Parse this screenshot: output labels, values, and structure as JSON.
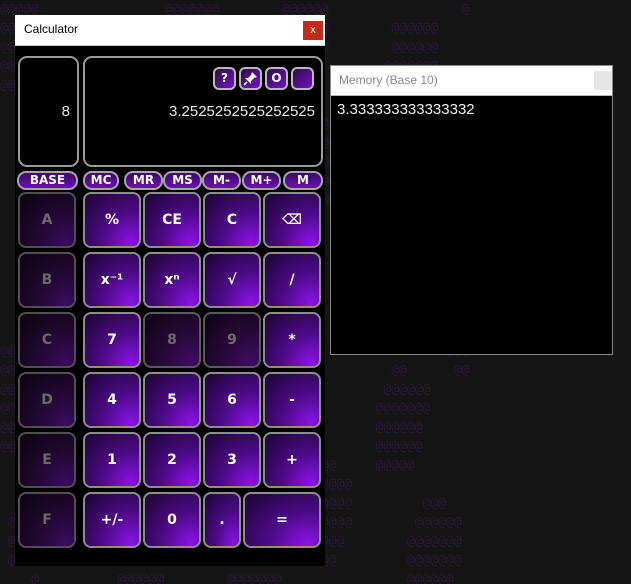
{
  "colors": {
    "accent": "#7a10c8",
    "close_red": "#c42b1c"
  },
  "calculator": {
    "title": "Calculator",
    "close_label": "x",
    "base_value": "8",
    "display_value": "3.2525252525252525",
    "tools": {
      "help": "?",
      "pin_icon": "pin-icon",
      "settings": "O",
      "toggle": ""
    },
    "memory_row": {
      "base": "BASE",
      "mc": "MC",
      "mr": "MR",
      "ms": "MS",
      "m_minus": "M-",
      "m_plus": "M+",
      "m": "M"
    },
    "keys": {
      "a": "A",
      "percent": "%",
      "ce": "CE",
      "c": "C",
      "backspace": "⌫",
      "b": "B",
      "inverse": "x⁻¹",
      "power": "xⁿ",
      "sqrt": "√",
      "divide": "/",
      "hex_c": "C",
      "seven": "7",
      "eight": "8",
      "nine": "9",
      "multiply": "*",
      "d": "D",
      "four": "4",
      "five": "5",
      "six": "6",
      "minus": "-",
      "e": "E",
      "one": "1",
      "two": "2",
      "three": "3",
      "plus": "+",
      "f": "F",
      "negate": "+/-",
      "zero": "0",
      "decimal": ".",
      "equals": "="
    }
  },
  "memory_window": {
    "title": "Memory (Base 10)",
    "value": "3.333333333333332"
  }
}
